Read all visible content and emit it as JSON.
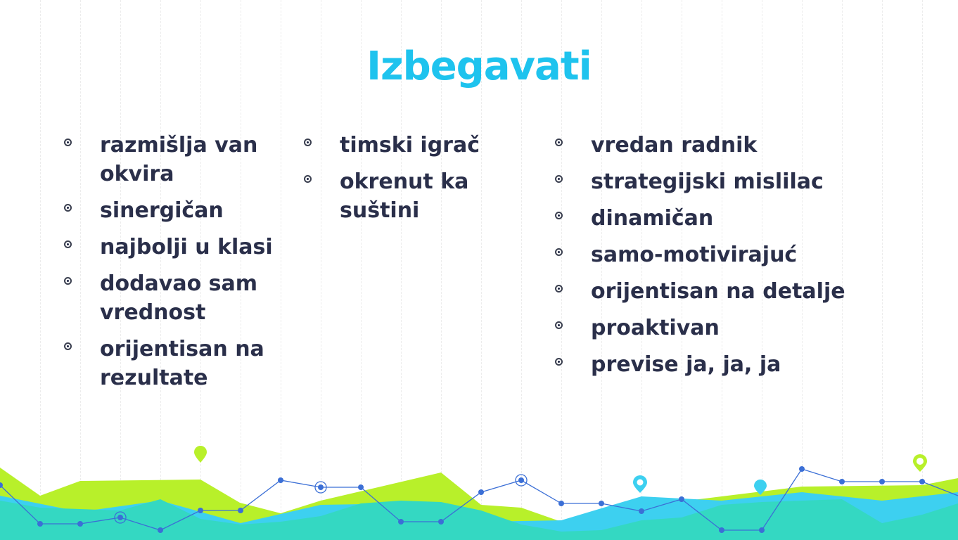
{
  "slide": {
    "title": "Izbegavati",
    "colors": {
      "title": "#1ec3ee",
      "text": "#2a2f4a",
      "lime": "#b8f02a",
      "cyan": "#3dd0f0",
      "teal": "#34d8c2",
      "line": "#3b6fd6"
    },
    "columns": [
      {
        "items": [
          "razmišlja van okvira",
          "sinergičan",
          "najbolji u klasi",
          "dodavao sam vrednost",
          "orijentisan na rezultate"
        ]
      },
      {
        "items": [
          "timski igrač",
          "okrenut ka suštini"
        ]
      },
      {
        "items": [
          "vredan radnik",
          "strategijski mislilac",
          "dinamičan",
          "samo-motivirajuć",
          "orijentisan na detalje",
          "proaktivan",
          "previse ja, ja, ja"
        ]
      }
    ],
    "bullet_icon": "radio-bullet-icon",
    "decoration_icons": [
      "map-pin-icon",
      "circle-marker-icon"
    ]
  }
}
